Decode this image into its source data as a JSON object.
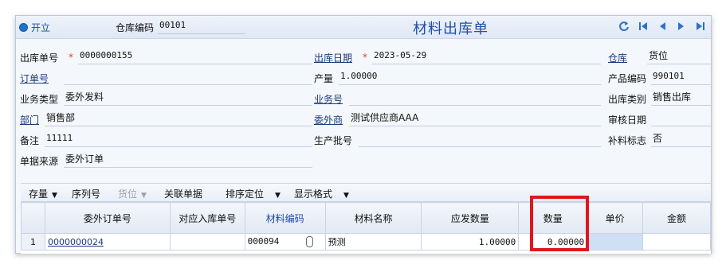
{
  "header": {
    "open_label": "开立",
    "warehouse_code_label": "仓库编码",
    "warehouse_code_value": "00101",
    "title": "材料出库单"
  },
  "nav_icons": [
    "refresh-icon",
    "first-page-icon",
    "prev-page-icon",
    "next-page-icon",
    "last-page-icon"
  ],
  "form": {
    "out_no_label": "出库单号",
    "out_no_value": "0000000155",
    "out_date_label": "出库日期",
    "out_date_value": "2023-05-29",
    "warehouse_label": "仓库",
    "warehouse_value": "货位",
    "order_no_label": "订单号",
    "order_no_value": "",
    "output_label": "产量",
    "output_value": "1.00000",
    "product_code_label": "产品编码",
    "product_code_value": "990101",
    "biz_type_label": "业务类型",
    "biz_type_value": "委外发料",
    "biz_no_label": "业务号",
    "biz_no_value": "",
    "out_category_label": "出库类别",
    "out_category_value": "销售出库",
    "dept_label": "部门",
    "dept_value": "销售部",
    "outsource_label": "委外商",
    "outsource_value": "测试供应商AAA",
    "audit_date_label": "审核日期",
    "audit_date_value": "",
    "note_label": "备注",
    "note_value": "11111",
    "batch_label": "生产批号",
    "batch_value": "",
    "supplement_label": "补料标志",
    "supplement_value": "否",
    "source_label": "单据来源",
    "source_value": "委外订单"
  },
  "toolbar": {
    "stock": "存量",
    "serial": "序列号",
    "location": "货位",
    "linked_docs": "关联单据",
    "sort_locate": "排序定位",
    "display_format": "显示格式"
  },
  "grid": {
    "columns": [
      "",
      "委外订单号",
      "对应入库单号",
      "材料编码",
      "材料名称",
      "应发数量",
      "数量",
      "单价",
      "金额"
    ],
    "rows": [
      {
        "no": "1",
        "order": "0000000024",
        "in_no": "",
        "code": "000094",
        "name": "预测",
        "due_qty": "1.00000",
        "qty": "0.00000",
        "price": "",
        "amount": ""
      }
    ]
  },
  "colors": {
    "title": "#1e4fa8",
    "highlight_box": "#e0161b",
    "required_star": "#d84a1b"
  }
}
